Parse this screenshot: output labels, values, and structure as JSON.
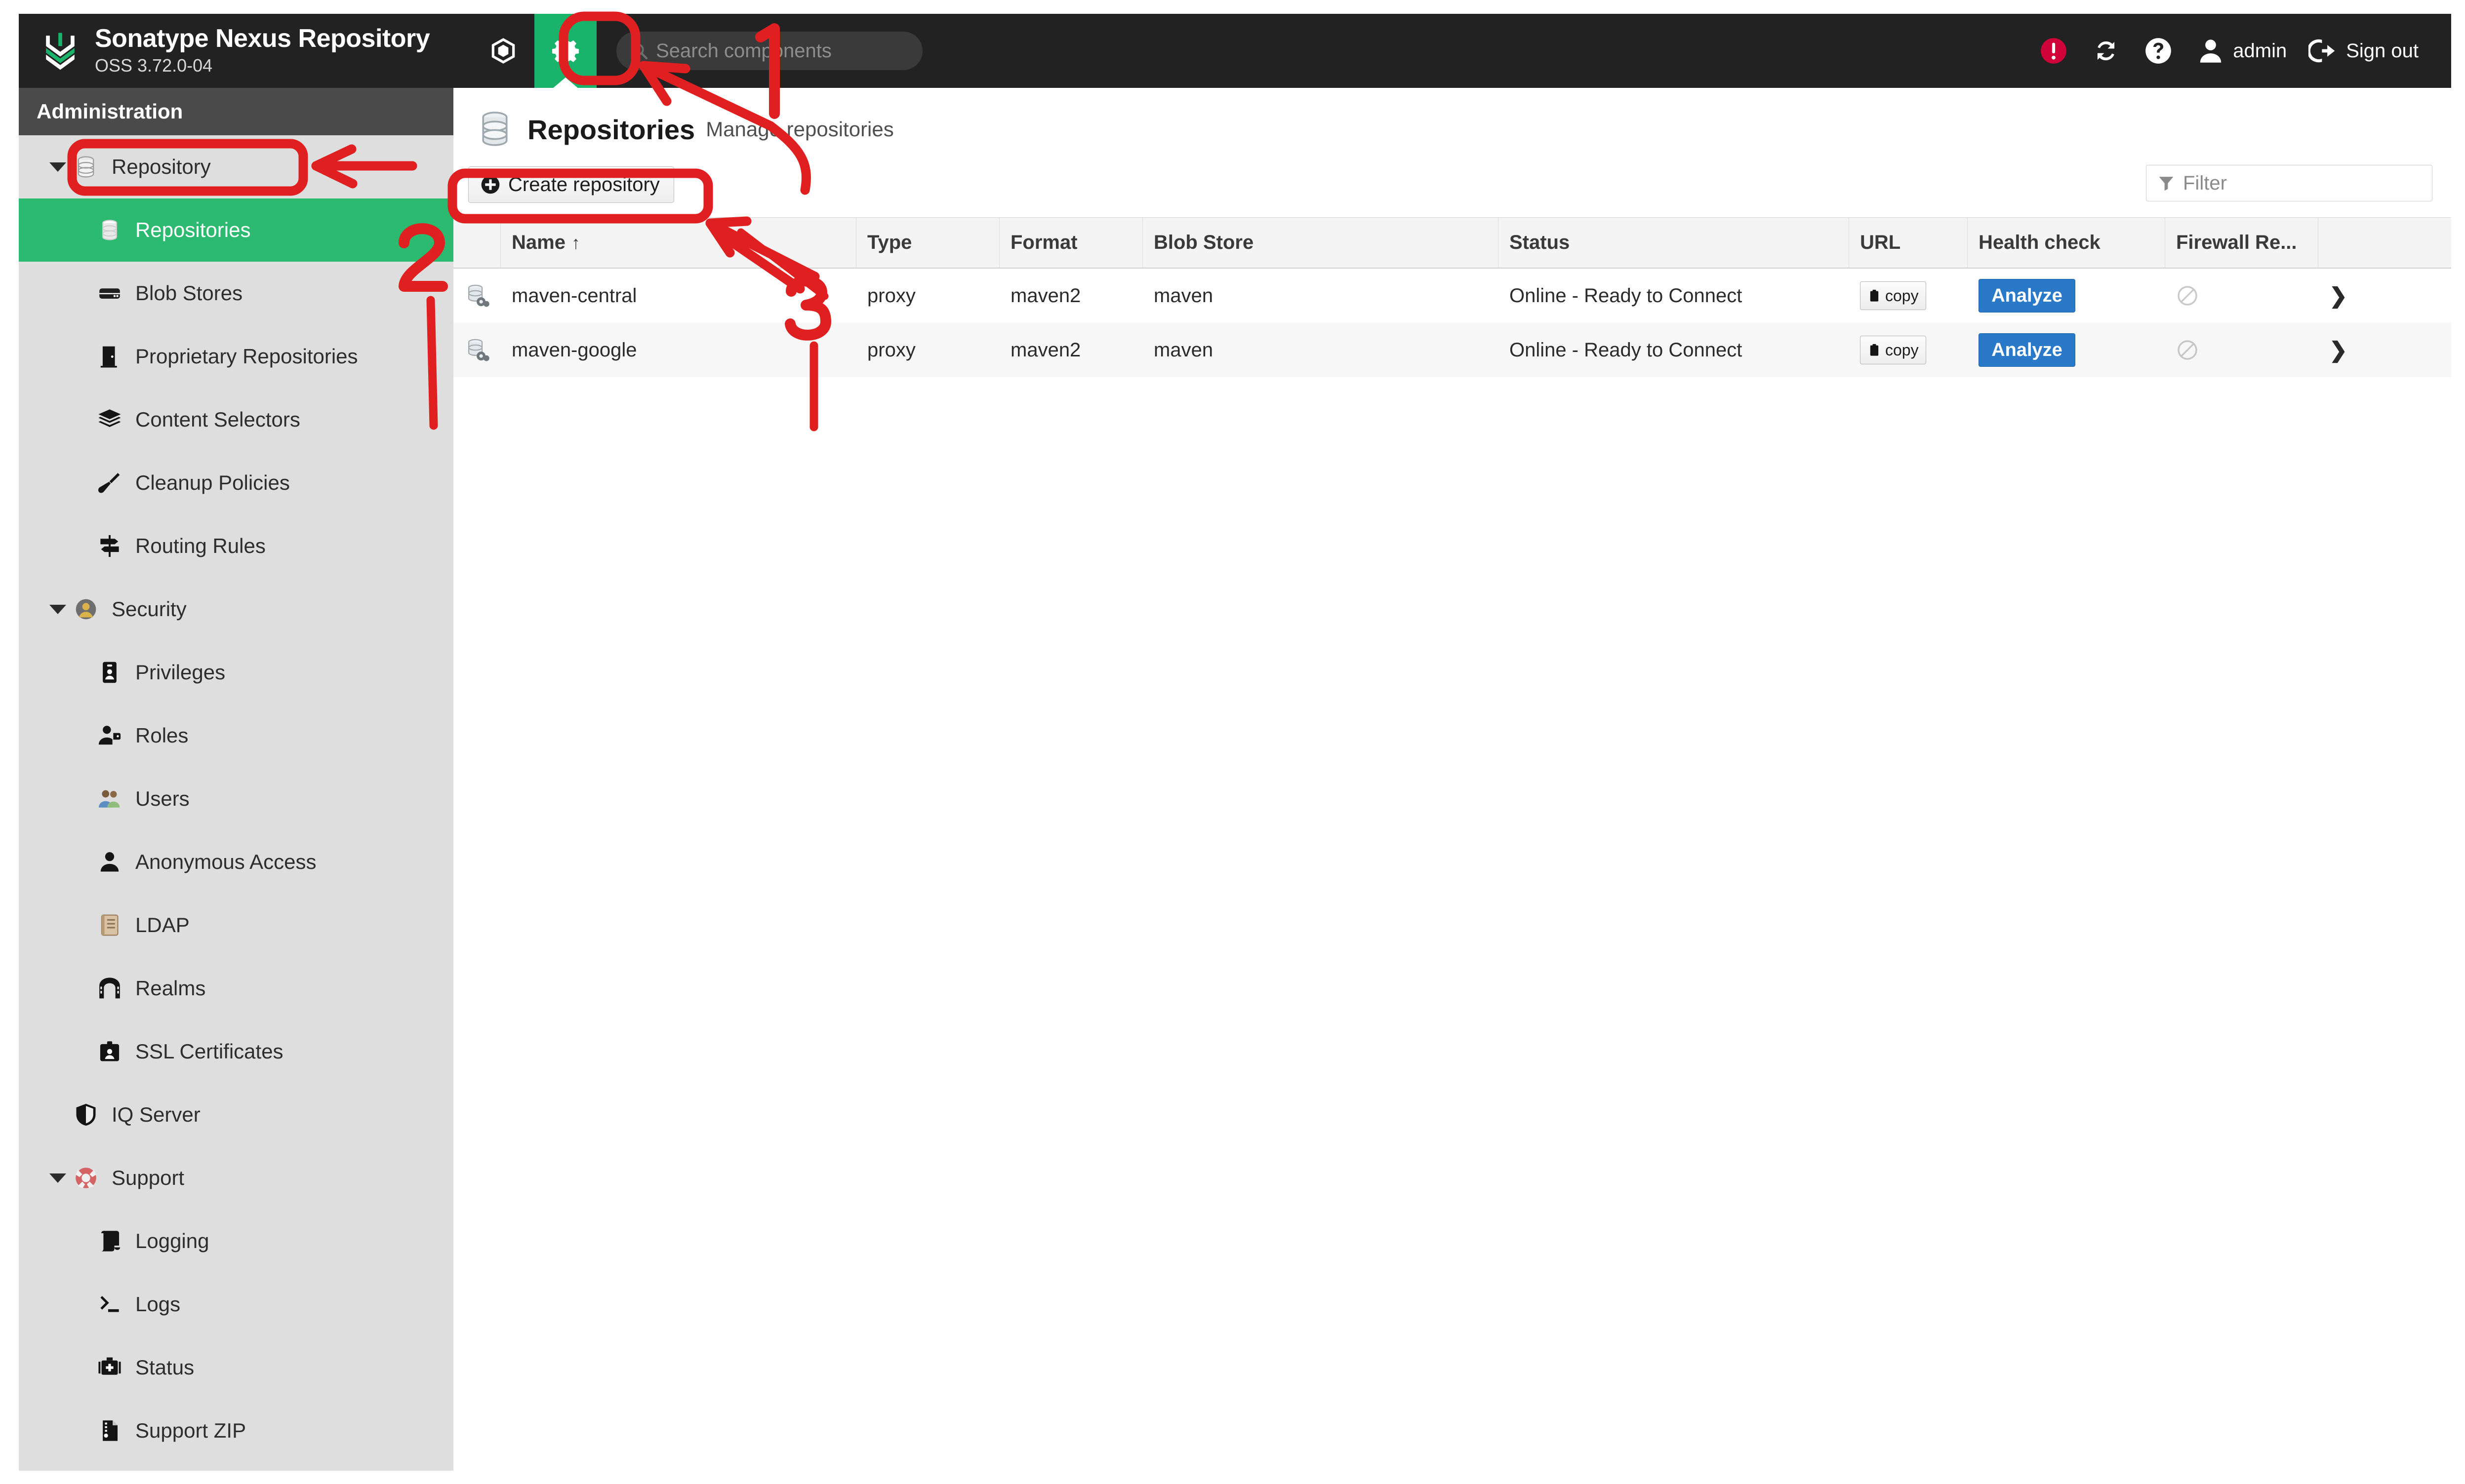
{
  "brand": {
    "title": "Sonatype Nexus Repository",
    "version": "OSS 3.72.0-04",
    "logo_icon": "nexus-chevron-logo"
  },
  "topnav": {
    "browse_icon": "cube-icon",
    "admin_icon": "gear-icon",
    "admin_active": true,
    "active_color": "#19b36b"
  },
  "search": {
    "placeholder": "Search components",
    "value": "",
    "icon": "search-icon"
  },
  "topright": {
    "items": [
      {
        "icon": "alert-circle-icon",
        "label": "",
        "color": "#d0023a"
      },
      {
        "icon": "refresh-icon",
        "label": ""
      },
      {
        "icon": "help-circle-icon",
        "label": ""
      },
      {
        "icon": "user-icon",
        "label": "admin"
      },
      {
        "icon": "sign-out-icon",
        "label": "Sign out"
      }
    ]
  },
  "sidebar": {
    "header": "Administration",
    "items": [
      {
        "label": "Repository",
        "icon": "database-icon",
        "level": "group",
        "caret": true,
        "selected": false
      },
      {
        "label": "Repositories",
        "icon": "database-icon",
        "level": "child",
        "caret": false,
        "selected": true
      },
      {
        "label": "Blob Stores",
        "icon": "hdd-icon",
        "level": "child",
        "caret": false,
        "selected": false
      },
      {
        "label": "Proprietary Repositories",
        "icon": "door-icon",
        "level": "child",
        "caret": false,
        "selected": false
      },
      {
        "label": "Content Selectors",
        "icon": "layers-icon",
        "level": "child",
        "caret": false,
        "selected": false
      },
      {
        "label": "Cleanup Policies",
        "icon": "broom-icon",
        "level": "child",
        "caret": false,
        "selected": false
      },
      {
        "label": "Routing Rules",
        "icon": "signpost-icon",
        "level": "child",
        "caret": false,
        "selected": false
      },
      {
        "label": "Security",
        "icon": "security-badge-icon",
        "level": "group",
        "caret": true,
        "selected": false
      },
      {
        "label": "Privileges",
        "icon": "id-badge-icon",
        "level": "child",
        "caret": false,
        "selected": false
      },
      {
        "label": "Roles",
        "icon": "user-tag-icon",
        "level": "child",
        "caret": false,
        "selected": false
      },
      {
        "label": "Users",
        "icon": "users-icon",
        "level": "child",
        "caret": false,
        "selected": false
      },
      {
        "label": "Anonymous Access",
        "icon": "user-icon",
        "level": "child",
        "caret": false,
        "selected": false
      },
      {
        "label": "LDAP",
        "icon": "address-book-icon",
        "level": "child",
        "caret": false,
        "selected": false
      },
      {
        "label": "Realms",
        "icon": "archway-icon",
        "level": "child",
        "caret": false,
        "selected": false
      },
      {
        "label": "SSL Certificates",
        "icon": "id-card-icon",
        "level": "child",
        "caret": false,
        "selected": false
      },
      {
        "label": "IQ Server",
        "icon": "shield-icon",
        "level": "group",
        "caret": false,
        "selected": false
      },
      {
        "label": "Support",
        "icon": "lifebuoy-icon",
        "level": "group",
        "caret": true,
        "selected": false
      },
      {
        "label": "Logging",
        "icon": "scroll-icon",
        "level": "child",
        "caret": false,
        "selected": false
      },
      {
        "label": "Logs",
        "icon": "terminal-icon",
        "level": "child",
        "caret": false,
        "selected": false
      },
      {
        "label": "Status",
        "icon": "medkit-icon",
        "level": "child",
        "caret": false,
        "selected": false
      },
      {
        "label": "Support ZIP",
        "icon": "file-zip-icon",
        "level": "child",
        "caret": false,
        "selected": false
      }
    ]
  },
  "page": {
    "icon": "database-icon",
    "title": "Repositories",
    "subtitle": "Manage repositories"
  },
  "toolbar": {
    "create_label": "Create repository",
    "create_icon": "plus-circle-icon",
    "filter_placeholder": "Filter",
    "filter_value": "",
    "filter_icon": "funnel-icon"
  },
  "table": {
    "columns": [
      {
        "key": "icon",
        "label": ""
      },
      {
        "key": "name",
        "label": "Name",
        "sort": "↑"
      },
      {
        "key": "type",
        "label": "Type"
      },
      {
        "key": "format",
        "label": "Format"
      },
      {
        "key": "blob",
        "label": "Blob Store"
      },
      {
        "key": "status",
        "label": "Status"
      },
      {
        "key": "url",
        "label": "URL"
      },
      {
        "key": "health",
        "label": "Health check"
      },
      {
        "key": "fw",
        "label": "Firewall Re..."
      },
      {
        "key": "chev",
        "label": ""
      }
    ],
    "rows": [
      {
        "icon": "repository-proxy-icon",
        "name": "maven-central",
        "type": "proxy",
        "format": "maven2",
        "blob": "maven",
        "status": "Online - Ready to Connect",
        "url_button": "copy",
        "url_icon": "clipboard-icon",
        "health_button": "Analyze",
        "firewall_icon": "no-entry-icon",
        "chevron": "❯"
      },
      {
        "icon": "repository-proxy-icon",
        "name": "maven-google",
        "type": "proxy",
        "format": "maven2",
        "blob": "maven",
        "status": "Online - Ready to Connect",
        "url_button": "copy",
        "url_icon": "clipboard-icon",
        "health_button": "Analyze",
        "firewall_icon": "no-entry-icon",
        "chevron": "❯"
      }
    ]
  },
  "annotations": {
    "color": "#e02020",
    "steps": [
      {
        "number": "1",
        "target": "gear-icon / admin button"
      },
      {
        "number": "2",
        "target": "Repositories sidebar item"
      },
      {
        "number": "3",
        "target": "Create repository button"
      }
    ]
  },
  "colors": {
    "topbar_bg": "#222222",
    "sidebar_bg": "#dedede",
    "sidebar_header_bg": "#4a4a4a",
    "accent_green": "#2bba6f",
    "analyze_blue": "#2a79c9",
    "alert_red": "#d0023a",
    "annotation_red": "#e02020"
  }
}
